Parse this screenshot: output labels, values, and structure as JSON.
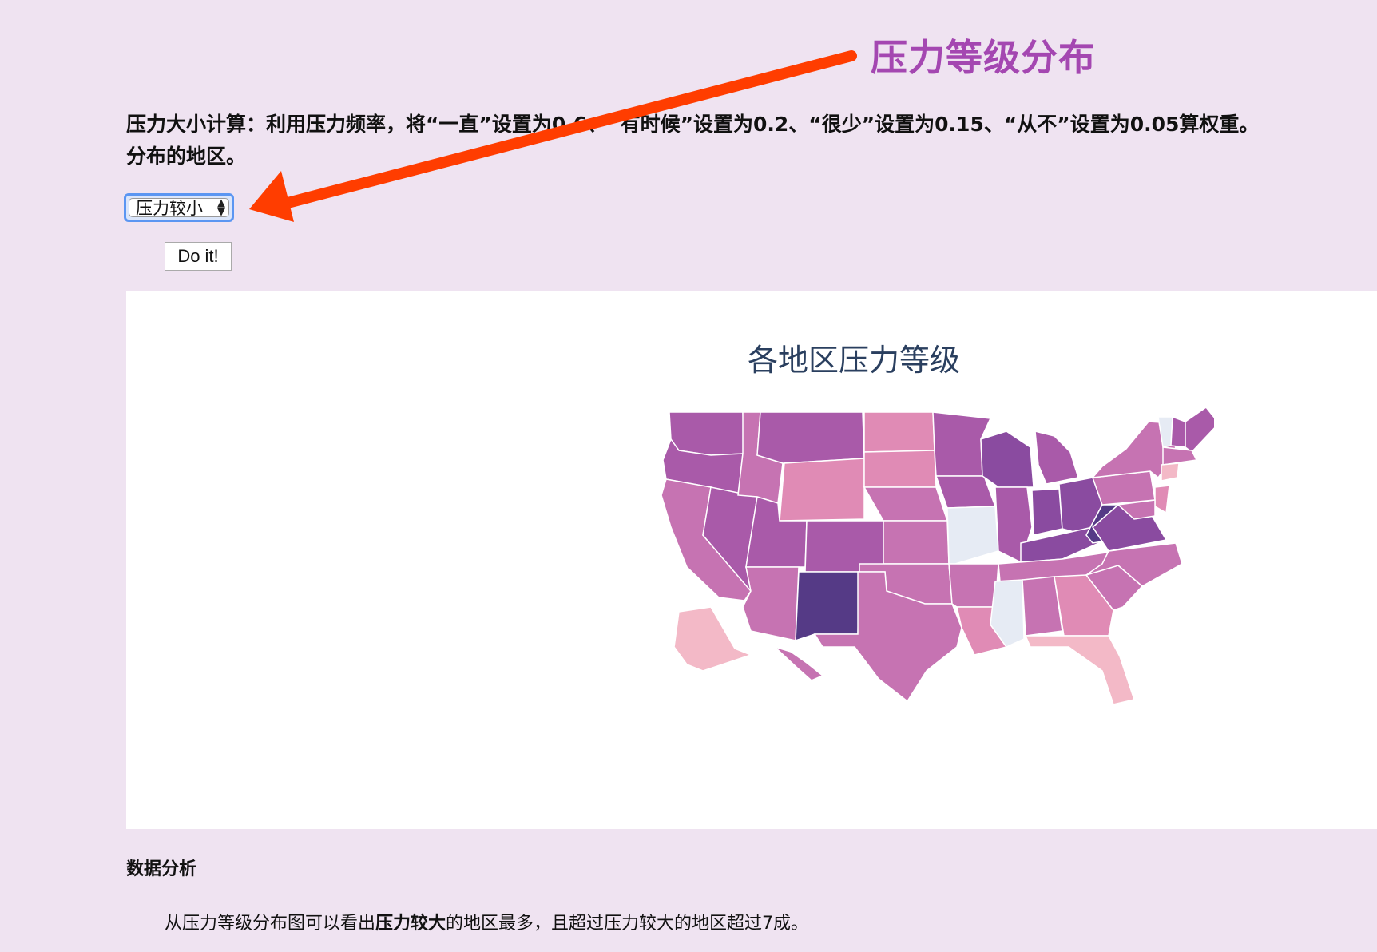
{
  "annotation": {
    "title": "压力等级分布",
    "arrow_color": "#ff3d00"
  },
  "intro": {
    "line1": "压力大小计算：利用压力频率，将“一直”设置为0.6、“有时候”设置为0.2、“很少”设置为0.15、“从不”设置为0.05算权重。",
    "line2": "分布的地区。"
  },
  "controls": {
    "select_value": "压力较小",
    "select_arrow": "▲▼",
    "button_label": "Do it!"
  },
  "chart": {
    "title": "各地区压力等级",
    "colors": {
      "light": "#e6ebf4",
      "pink_light": "#f3b9c7",
      "pink": "#e08bb5",
      "mauve": "#c673b2",
      "purple": "#a95aa9",
      "purple_dark": "#8a4ba0",
      "darkest": "#553a86"
    }
  },
  "chart_data": {
    "type": "choropleth",
    "title": "各地区压力等级",
    "regions": [
      {
        "state": "WA",
        "level": "purple"
      },
      {
        "state": "OR",
        "level": "purple"
      },
      {
        "state": "CA",
        "level": "mauve"
      },
      {
        "state": "NV",
        "level": "purple"
      },
      {
        "state": "ID",
        "level": "mauve"
      },
      {
        "state": "MT",
        "level": "purple"
      },
      {
        "state": "WY",
        "level": "pink"
      },
      {
        "state": "UT",
        "level": "purple"
      },
      {
        "state": "AZ",
        "level": "mauve"
      },
      {
        "state": "CO",
        "level": "purple"
      },
      {
        "state": "NM",
        "level": "darkest"
      },
      {
        "state": "ND",
        "level": "pink"
      },
      {
        "state": "SD",
        "level": "pink"
      },
      {
        "state": "NE",
        "level": "mauve"
      },
      {
        "state": "KS",
        "level": "mauve"
      },
      {
        "state": "OK",
        "level": "mauve"
      },
      {
        "state": "TX",
        "level": "mauve"
      },
      {
        "state": "MN",
        "level": "purple"
      },
      {
        "state": "IA",
        "level": "purple"
      },
      {
        "state": "MO",
        "level": "light"
      },
      {
        "state": "AR",
        "level": "mauve"
      },
      {
        "state": "LA",
        "level": "pink"
      },
      {
        "state": "WI",
        "level": "purple_dark"
      },
      {
        "state": "IL",
        "level": "purple"
      },
      {
        "state": "MI",
        "level": "purple"
      },
      {
        "state": "IN",
        "level": "purple_dark"
      },
      {
        "state": "OH",
        "level": "purple_dark"
      },
      {
        "state": "KY",
        "level": "purple_dark"
      },
      {
        "state": "TN",
        "level": "mauve"
      },
      {
        "state": "MS",
        "level": "light"
      },
      {
        "state": "AL",
        "level": "mauve"
      },
      {
        "state": "GA",
        "level": "pink"
      },
      {
        "state": "FL",
        "level": "pink_light"
      },
      {
        "state": "SC",
        "level": "mauve"
      },
      {
        "state": "NC",
        "level": "mauve"
      },
      {
        "state": "VA",
        "level": "purple_dark"
      },
      {
        "state": "WV",
        "level": "darkest"
      },
      {
        "state": "PA",
        "level": "mauve"
      },
      {
        "state": "NY",
        "level": "mauve"
      },
      {
        "state": "VT",
        "level": "light"
      },
      {
        "state": "NH",
        "level": "purple"
      },
      {
        "state": "ME",
        "level": "purple"
      },
      {
        "state": "MA",
        "level": "mauve"
      },
      {
        "state": "CT",
        "level": "pink_light"
      },
      {
        "state": "NJ",
        "level": "pink"
      },
      {
        "state": "MD",
        "level": "mauve"
      },
      {
        "state": "AK",
        "level": "pink_light"
      },
      {
        "state": "HI",
        "level": "mauve"
      }
    ]
  },
  "analysis": {
    "heading": "数据分析",
    "text_pre": "从压力等级分布图可以看出",
    "text_bold": "压力较大",
    "text_post": "的地区最多，且超过压力较大的地区超过7成。"
  }
}
